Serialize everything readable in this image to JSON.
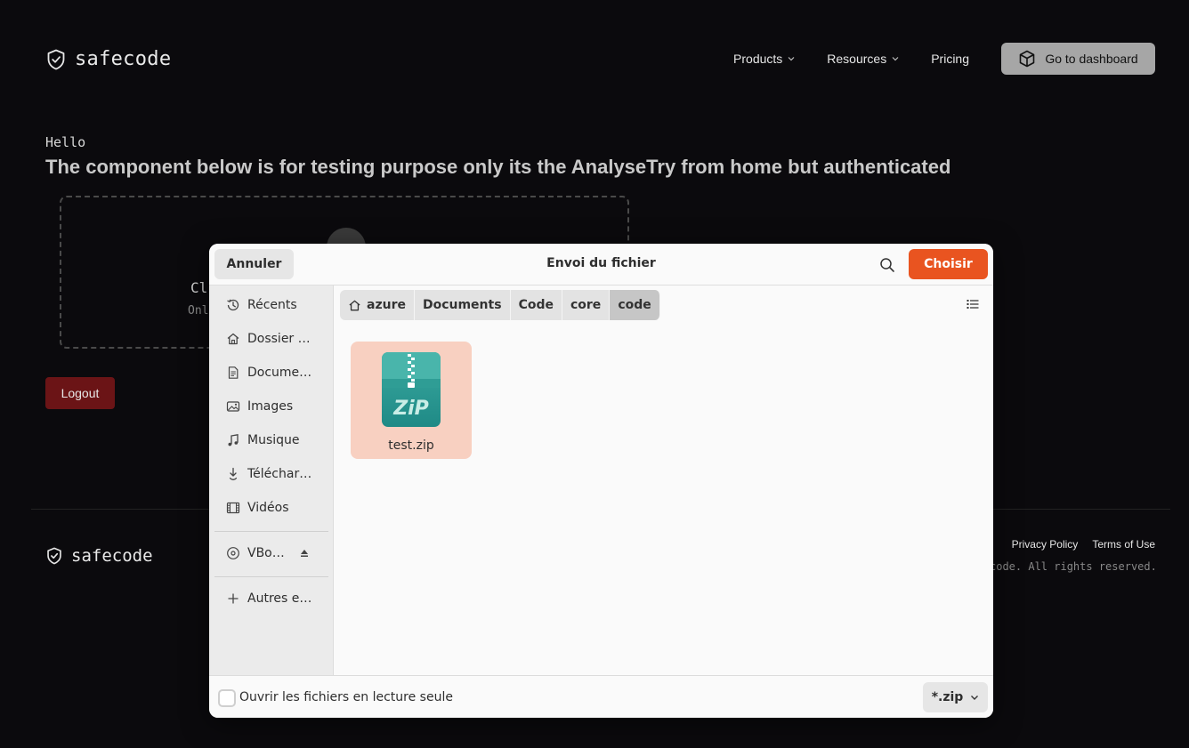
{
  "site": {
    "brand": "safecode",
    "nav": {
      "products": "Products",
      "resources": "Resources",
      "pricing": "Pricing",
      "dashboard": "Go to dashboard"
    },
    "hello": "Hello",
    "heading": "The component below is for testing purpose only its the AnalyseTry from home but authenticated",
    "dropzone": {
      "title_partial": "Cl",
      "subtitle_partial": "Onl"
    },
    "logout": "Logout",
    "footer": {
      "brand": "safecode",
      "privacy": "Privacy Policy",
      "terms": "Terms of Use",
      "copyright_partial": "code. All rights reserved."
    }
  },
  "dialog": {
    "title": "Envoi du fichier",
    "cancel": "Annuler",
    "choose": "Choisir",
    "accent": "#e95420",
    "sidebar": [
      {
        "label": "Récents",
        "icon": "clock-icon"
      },
      {
        "label": "Dossier …",
        "icon": "home-icon"
      },
      {
        "label": "Docume…",
        "icon": "document-icon"
      },
      {
        "label": "Images",
        "icon": "image-icon"
      },
      {
        "label": "Musique",
        "icon": "music-icon"
      },
      {
        "label": "Téléchar…",
        "icon": "download-icon"
      },
      {
        "label": "Vidéos",
        "icon": "film-icon"
      }
    ],
    "devices": [
      {
        "label": "VBo…",
        "icon": "disc-icon"
      }
    ],
    "other": {
      "label": "Autres e…",
      "icon": "plus-icon"
    },
    "path": [
      "azure",
      "Documents",
      "Code",
      "core",
      "code"
    ],
    "files": [
      {
        "name": "test.zip",
        "icon": "zip-file-icon",
        "selected": true
      }
    ],
    "readonly_label": "Ouvrir les fichiers en lecture seule",
    "filter": "*.zip"
  }
}
